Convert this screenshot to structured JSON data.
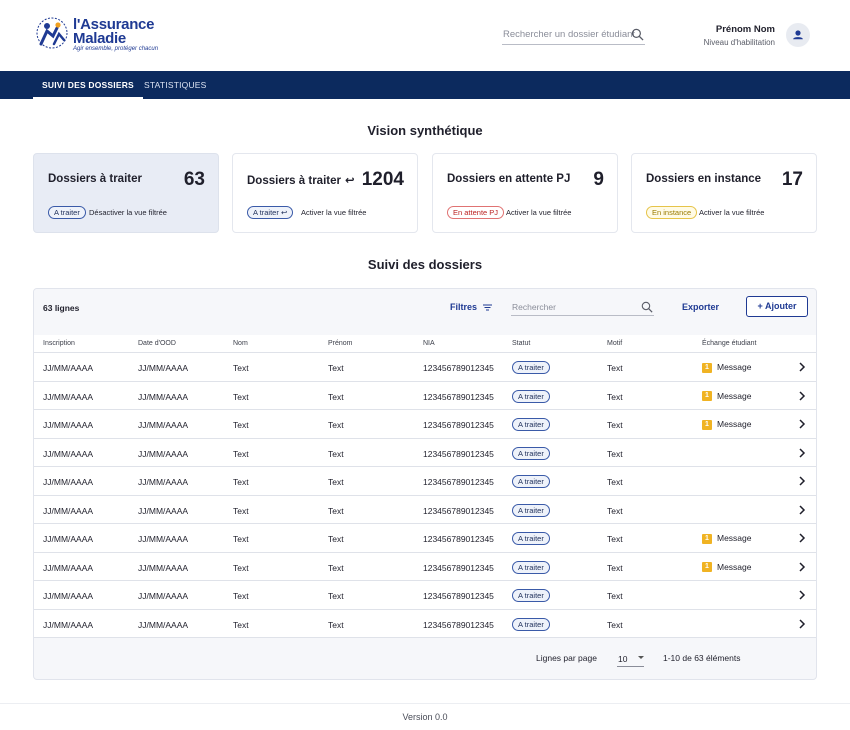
{
  "brand": {
    "name_line1": "l'Assurance",
    "name_line2": "Maladie",
    "tagline": "Agir ensemble, protéger chacun",
    "color": "#1f3a93"
  },
  "header": {
    "search_placeholder": "Rechercher un dossier étudiant",
    "user_name": "Prénom Nom",
    "user_role": "Niveau d'habilitation"
  },
  "nav": {
    "tabs": [
      {
        "label": "SUIVI DES DOSSIERS",
        "active": true
      },
      {
        "label": "STATISTIQUES",
        "active": false
      }
    ],
    "color": "#0c2a5e"
  },
  "summary": {
    "title": "Vision synthétique",
    "cards": [
      {
        "title": "Dossiers à traiter",
        "arrow": "",
        "count": "63",
        "badge": "A traiter",
        "badge_arrow": "",
        "action": "Désactiver la vue filtrée",
        "highlight": true
      },
      {
        "title": "Dossiers à traiter",
        "arrow": "↩",
        "count": "1204",
        "badge": "A traiter",
        "badge_arrow": "↩",
        "action": "Activer la vue filtrée",
        "highlight": false
      },
      {
        "title": "Dossiers en attente PJ",
        "arrow": "",
        "count": "9",
        "badge": "En attente PJ",
        "badge_arrow": "",
        "action": "Activer la vue filtrée",
        "highlight": false
      },
      {
        "title": "Dossiers en instance",
        "arrow": "",
        "count": "17",
        "badge": "En instance",
        "badge_arrow": "",
        "action": "Activer la vue filtrée",
        "highlight": false
      }
    ]
  },
  "table": {
    "title": "Suivi des dossiers",
    "row_count": "63 lignes",
    "filters_label": "Filtres",
    "search_placeholder": "Rechercher",
    "export_label": "Exporter",
    "add_label": "+ Ajouter",
    "columns": [
      "Inscription",
      "Date d'OOD",
      "Nom",
      "Prénom",
      "NIA",
      "Statut",
      "Motif",
      "Échange étudiant"
    ],
    "rows": [
      {
        "inscription": "JJ/MM/AAAA",
        "date_ood": "JJ/MM/AAAA",
        "nom": "Text",
        "prenom": "Text",
        "nia": "123456789012345",
        "statut": "A traiter",
        "motif": "Text",
        "message": "Message"
      },
      {
        "inscription": "JJ/MM/AAAA",
        "date_ood": "JJ/MM/AAAA",
        "nom": "Text",
        "prenom": "Text",
        "nia": "123456789012345",
        "statut": "A traiter",
        "motif": "Text",
        "message": "Message"
      },
      {
        "inscription": "JJ/MM/AAAA",
        "date_ood": "JJ/MM/AAAA",
        "nom": "Text",
        "prenom": "Text",
        "nia": "123456789012345",
        "statut": "A traiter",
        "motif": "Text",
        "message": "Message"
      },
      {
        "inscription": "JJ/MM/AAAA",
        "date_ood": "JJ/MM/AAAA",
        "nom": "Text",
        "prenom": "Text",
        "nia": "123456789012345",
        "statut": "A traiter",
        "motif": "Text",
        "message": ""
      },
      {
        "inscription": "JJ/MM/AAAA",
        "date_ood": "JJ/MM/AAAA",
        "nom": "Text",
        "prenom": "Text",
        "nia": "123456789012345",
        "statut": "A traiter",
        "motif": "Text",
        "message": ""
      },
      {
        "inscription": "JJ/MM/AAAA",
        "date_ood": "JJ/MM/AAAA",
        "nom": "Text",
        "prenom": "Text",
        "nia": "123456789012345",
        "statut": "A traiter",
        "motif": "Text",
        "message": ""
      },
      {
        "inscription": "JJ/MM/AAAA",
        "date_ood": "JJ/MM/AAAA",
        "nom": "Text",
        "prenom": "Text",
        "nia": "123456789012345",
        "statut": "A traiter",
        "motif": "Text",
        "message": "Message"
      },
      {
        "inscription": "JJ/MM/AAAA",
        "date_ood": "JJ/MM/AAAA",
        "nom": "Text",
        "prenom": "Text",
        "nia": "123456789012345",
        "statut": "A traiter",
        "motif": "Text",
        "message": "Message"
      },
      {
        "inscription": "JJ/MM/AAAA",
        "date_ood": "JJ/MM/AAAA",
        "nom": "Text",
        "prenom": "Text",
        "nia": "123456789012345",
        "statut": "A traiter",
        "motif": "Text",
        "message": ""
      },
      {
        "inscription": "JJ/MM/AAAA",
        "date_ood": "JJ/MM/AAAA",
        "nom": "Text",
        "prenom": "Text",
        "nia": "123456789012345",
        "statut": "A traiter",
        "motif": "Text",
        "message": ""
      }
    ],
    "message_icon": "1",
    "pagination": {
      "label": "Lignes par page",
      "per_page": "10",
      "range": "1-10 de 63 éléments"
    }
  },
  "footer": {
    "version": "Version 0.0"
  }
}
